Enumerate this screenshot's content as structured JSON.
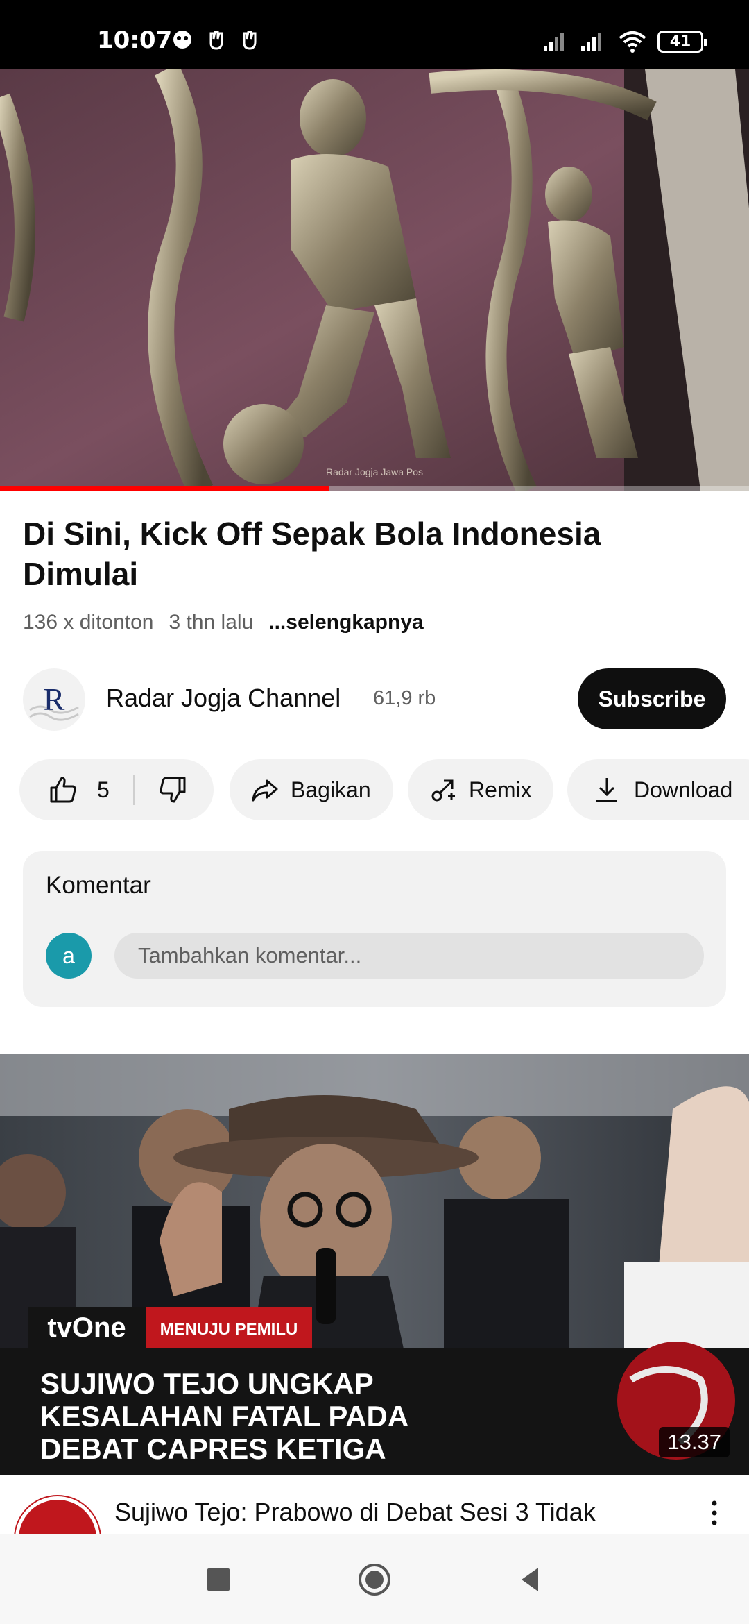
{
  "status_bar": {
    "time": "10:07",
    "battery": "41"
  },
  "video": {
    "title": "Di Sini, Kick Off Sepak Bola Indonesia Dimulai",
    "views": "136 x ditonton",
    "age": "3 thn lalu",
    "more_label": "...selengkapnya",
    "progress": 0.44,
    "watermark": "Radar Jogja Jawa Pos"
  },
  "channel": {
    "name": "Radar Jogja Channel",
    "subscribers": "61,9 rb",
    "avatar_letter": "R",
    "subscribe_label": "Subscribe"
  },
  "actions": {
    "like_count": "5",
    "share_label": "Bagikan",
    "remix_label": "Remix",
    "download_label": "Download"
  },
  "comments": {
    "title": "Komentar",
    "user_initial": "a",
    "placeholder": "Tambahkan komentar..."
  },
  "recommended": {
    "brand": "tvOne",
    "tag": "MENUJU PEMILU",
    "headline_lines": [
      "SUJIWO TEJO UNGKAP",
      "KESALAHAN FATAL PADA",
      "DEBAT CAPRES KETIGA"
    ],
    "duration": "13.37",
    "title": "Sujiwo Tejo: Prabowo di Debat Sesi 3 Tidak"
  },
  "colors": {
    "accent_red": "#ff0000",
    "comment_avatar": "#1a9aaa",
    "tvone_red": "#c0171d"
  }
}
